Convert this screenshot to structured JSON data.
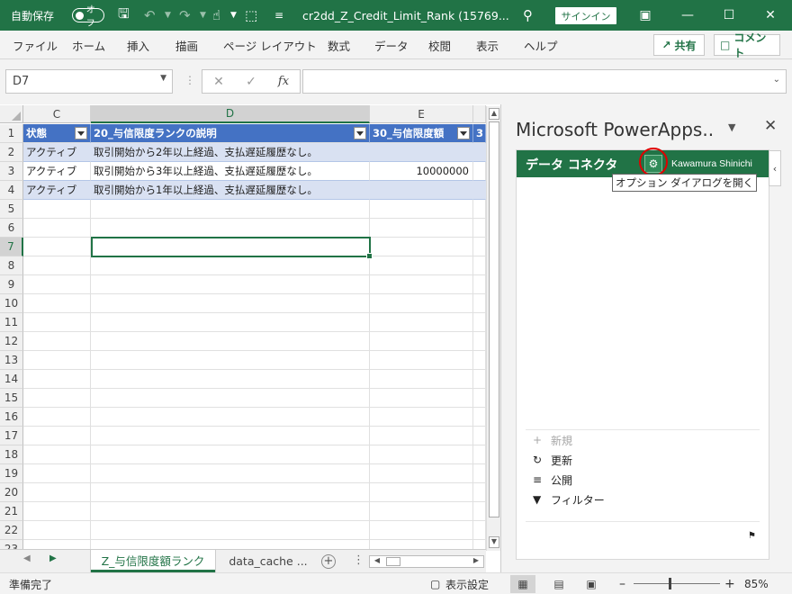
{
  "titlebar": {
    "autosave_label": "自動保存",
    "autosave_state": "オフ",
    "doc_title": "cr2dd_Z_Credit_Limit_Rank (15769...",
    "signin": "サインイン"
  },
  "ribbon": {
    "tabs": [
      "ファイル",
      "ホーム",
      "挿入",
      "描画",
      "ページ レイアウト",
      "数式",
      "データ",
      "校閲",
      "表示",
      "ヘルプ"
    ],
    "share": "共有",
    "comment": "コメント"
  },
  "formula_bar": {
    "name_box": "D7",
    "fx": "fx",
    "value": ""
  },
  "grid": {
    "columns": [
      "C",
      "D",
      "E"
    ],
    "rows": [
      "1",
      "2",
      "3",
      "4",
      "5",
      "6",
      "7",
      "8",
      "9",
      "10",
      "11",
      "12",
      "13",
      "14",
      "15",
      "16",
      "17",
      "18",
      "19",
      "20",
      "21",
      "22",
      "23"
    ],
    "headers": [
      "状態",
      "20_与信限度ランクの説明",
      "30_与信限度額",
      "3"
    ],
    "data": [
      [
        "アクティブ",
        "取引開始から2年以上経過、支払遅延履歴なし。",
        ""
      ],
      [
        "アクティブ",
        "取引開始から3年以上経過、支払遅延履歴なし。",
        "10000000"
      ],
      [
        "アクティブ",
        "取引開始から1年以上経過、支払遅延履歴なし。",
        ""
      ]
    ]
  },
  "sheets": {
    "active": "Z_与信限度額ランク",
    "other": "data_cache ..."
  },
  "panel": {
    "title": "Microsoft PowerApps..",
    "connector_label": "データ コネクタ",
    "user": "Kawamura Shinichi",
    "tooltip": "オプション ダイアログを開く",
    "commands": {
      "new": "新規",
      "refresh": "更新",
      "publish": "公開",
      "filter": "フィルター"
    }
  },
  "status": {
    "ready": "準備完了",
    "display_settings": "表示設定",
    "zoom": "85%"
  },
  "zoom_level": 0.85
}
